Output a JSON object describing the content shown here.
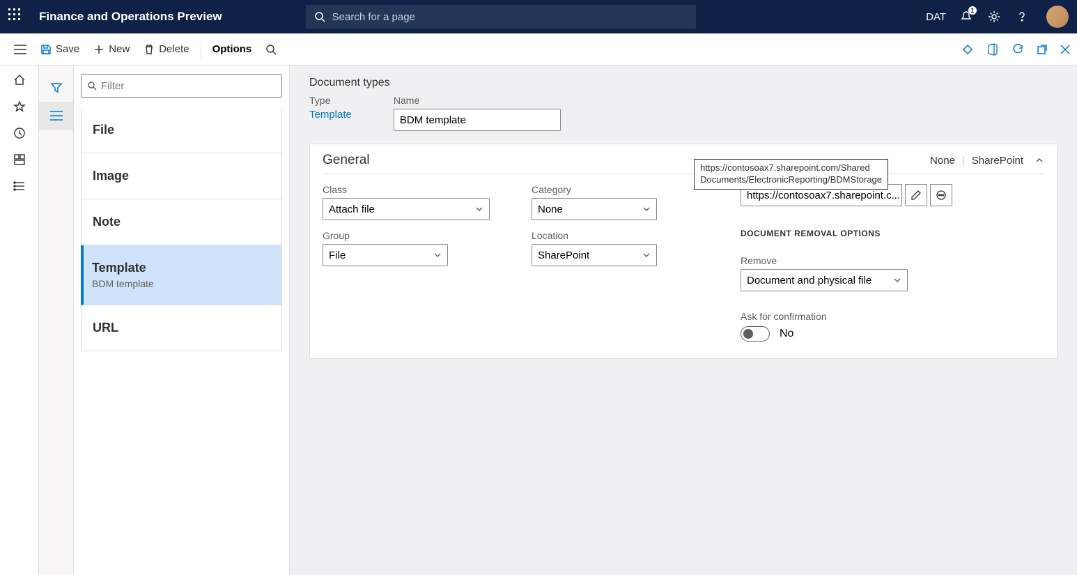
{
  "titlebar": {
    "app_title": "Finance and Operations Preview",
    "search_placeholder": "Search for a page",
    "company": "DAT",
    "notification_count": "1"
  },
  "actionbar": {
    "save": "Save",
    "new": "New",
    "delete": "Delete",
    "options": "Options"
  },
  "list": {
    "filter_placeholder": "Filter",
    "items": [
      {
        "title": "File",
        "sub": ""
      },
      {
        "title": "Image",
        "sub": ""
      },
      {
        "title": "Note",
        "sub": ""
      },
      {
        "title": "Template",
        "sub": "BDM template"
      },
      {
        "title": "URL",
        "sub": ""
      }
    ]
  },
  "main": {
    "page_title": "Document types",
    "type_label": "Type",
    "type_value": "Template",
    "name_label": "Name",
    "name_value": "BDM template"
  },
  "card": {
    "title": "General",
    "pivot_none": "None",
    "pivot_sharepoint": "SharePoint",
    "class_label": "Class",
    "class_value": "Attach file",
    "group_label": "Group",
    "group_value": "File",
    "category_label": "Category",
    "category_value": "None",
    "location_label": "Location",
    "location_value": "SharePoint",
    "sp_tooltip": "https://contosoax7.sharepoint.com/Shared Documents/ElectronicReporting/BDMStorage",
    "sp_display": "https://contosoax7.sharepoint.c...",
    "removal_section": "DOCUMENT REMOVAL OPTIONS",
    "remove_label": "Remove",
    "remove_value": "Document and physical file",
    "ask_label": "Ask for confirmation",
    "ask_value": "No"
  }
}
